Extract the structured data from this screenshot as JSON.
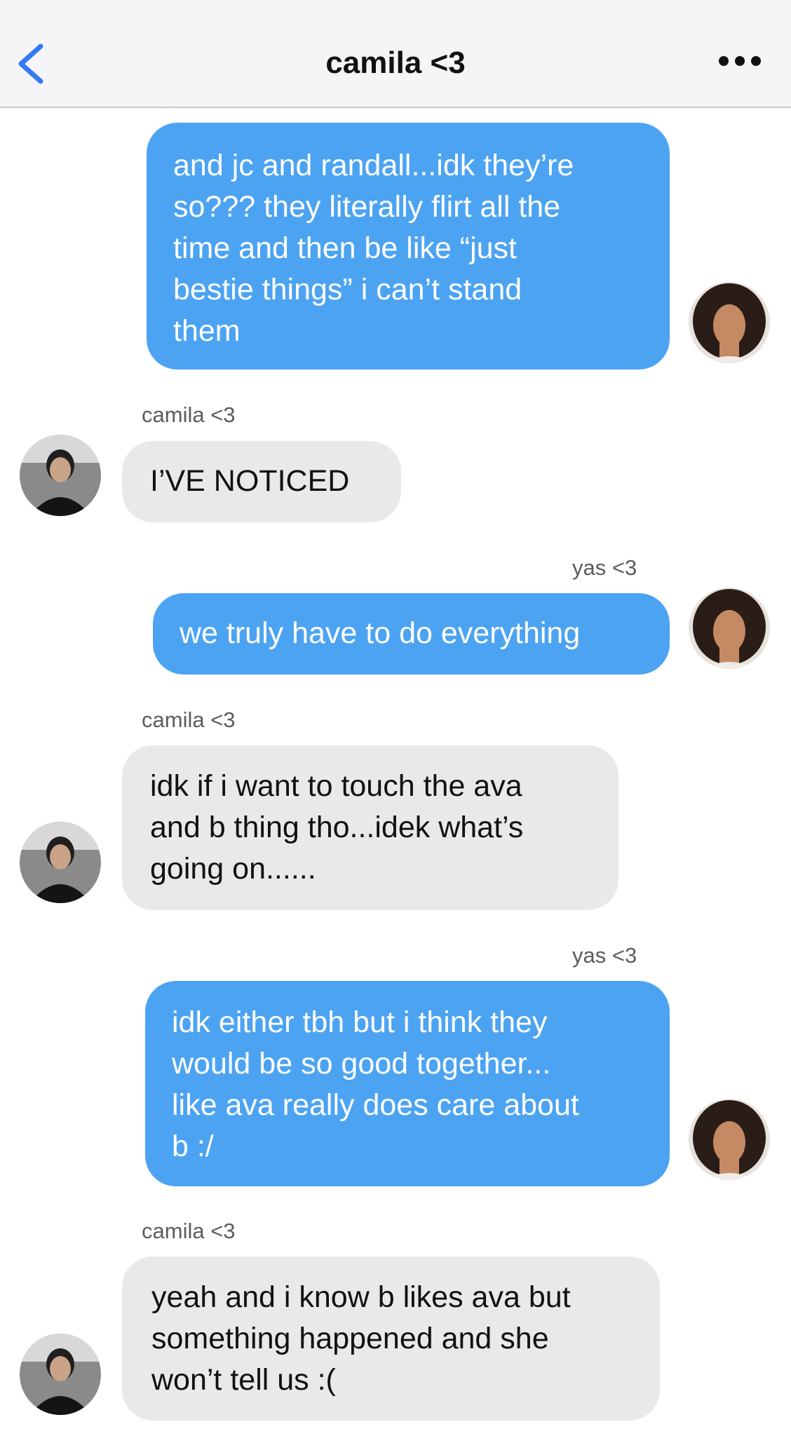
{
  "header": {
    "title": "camila <3",
    "back_icon": "chevron-left-icon",
    "more_icon": "ellipsis-icon",
    "accent_color": "#3478f6"
  },
  "colors": {
    "outgoing_bubble": "#4ca3f2",
    "incoming_bubble": "#e9e9eb",
    "header_bg": "#f5f5f7"
  },
  "messages": [
    {
      "direction": "outgoing",
      "sender": "",
      "lines": [
        "and jc and randall...idk they’re",
        "so??? they literally flirt all the",
        "time and then be like “just",
        "bestie things” i can’t stand",
        "them"
      ]
    },
    {
      "direction": "incoming",
      "sender": "camila <3",
      "lines": [
        "I’VE NOTICED"
      ]
    },
    {
      "direction": "outgoing",
      "sender": "yas <3",
      "lines": [
        "we truly have to do everything"
      ]
    },
    {
      "direction": "incoming",
      "sender": "camila <3",
      "lines": [
        "idk if i want to touch the ava",
        "and b thing tho...idek what’s",
        "going on......"
      ]
    },
    {
      "direction": "outgoing",
      "sender": "yas <3",
      "lines": [
        "idk either tbh but i think they",
        "would be so good together...",
        "like ava really does care about",
        "b :/"
      ]
    },
    {
      "direction": "incoming",
      "sender": "camila <3",
      "lines": [
        "yeah and i know b likes ava but",
        "something happened and she",
        "won’t tell us :("
      ]
    }
  ]
}
